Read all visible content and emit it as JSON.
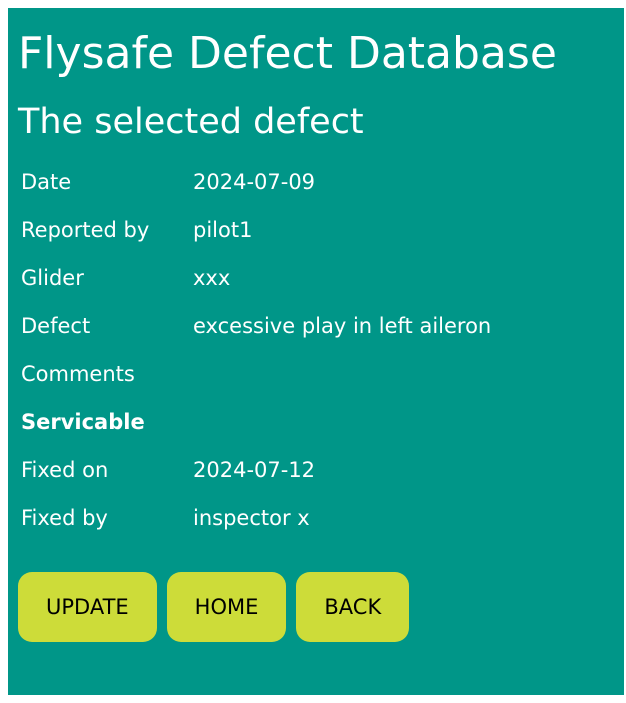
{
  "header": {
    "app_title": "Flysafe Defect Database",
    "section_title": "The selected defect"
  },
  "defect": {
    "date": {
      "label": "Date",
      "value": "2024-07-09"
    },
    "reported_by": {
      "label": "Reported by",
      "value": "pilot1"
    },
    "glider": {
      "label": "Glider",
      "value": "xxx"
    },
    "defect": {
      "label": "Defect",
      "value": "excessive play in left aileron"
    },
    "comments": {
      "label": "Comments",
      "value": ""
    },
    "status": {
      "label": "Servicable"
    },
    "fixed_on": {
      "label": "Fixed on",
      "value": "2024-07-12"
    },
    "fixed_by": {
      "label": "Fixed by",
      "value": "inspector x"
    }
  },
  "actions": {
    "update_label": "UPDATE",
    "home_label": "HOME",
    "back_label": "BACK"
  },
  "colors": {
    "panel_background": "#009688",
    "button_background": "#cddc39",
    "text": "#ffffff"
  }
}
